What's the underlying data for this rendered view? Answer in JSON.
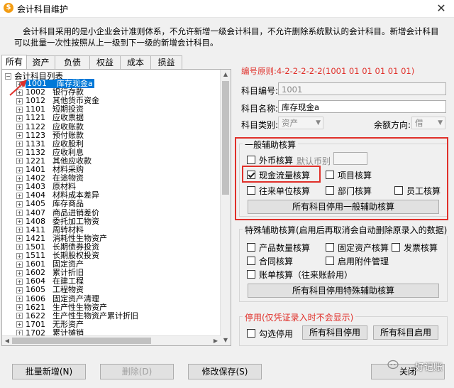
{
  "window": {
    "title": "会计科目维护",
    "close_label": "✕"
  },
  "intro_text": "会计科目采用的是小企业会计准则体系，不允许新增一级会计科目，不允许删除系统默认的会计科目。新增会计科目可以批量一次性按照从上一级到下一级的新增会计科目。",
  "tabs": [
    "所有",
    "资产",
    "负债",
    "权益",
    "成本",
    "损益"
  ],
  "tree": {
    "root_label": "会计科目列表",
    "items": [
      {
        "code": "1001",
        "name": "库存现金a"
      },
      {
        "code": "1002",
        "name": "银行存款"
      },
      {
        "code": "1012",
        "name": "其他货币资金"
      },
      {
        "code": "1101",
        "name": "短期投资"
      },
      {
        "code": "1121",
        "name": "应收票据"
      },
      {
        "code": "1122",
        "name": "应收账款"
      },
      {
        "code": "1123",
        "name": "预付账款"
      },
      {
        "code": "1131",
        "name": "应收股利"
      },
      {
        "code": "1132",
        "name": "应收利息"
      },
      {
        "code": "1221",
        "name": "其他应收款"
      },
      {
        "code": "1401",
        "name": "材料采购"
      },
      {
        "code": "1402",
        "name": "在途物资"
      },
      {
        "code": "1403",
        "name": "原材料"
      },
      {
        "code": "1404",
        "name": "材料成本差异"
      },
      {
        "code": "1405",
        "name": "库存商品"
      },
      {
        "code": "1407",
        "name": "商品进销差价"
      },
      {
        "code": "1408",
        "name": "委托加工物资"
      },
      {
        "code": "1411",
        "name": "周转材料"
      },
      {
        "code": "1421",
        "name": "消耗性生物资产"
      },
      {
        "code": "1501",
        "name": "长期债券投资"
      },
      {
        "code": "1511",
        "name": "长期股权投资"
      },
      {
        "code": "1601",
        "name": "固定资产"
      },
      {
        "code": "1602",
        "name": "累计折旧"
      },
      {
        "code": "1604",
        "name": "在建工程"
      },
      {
        "code": "1605",
        "name": "工程物资"
      },
      {
        "code": "1606",
        "name": "固定资产清理"
      },
      {
        "code": "1621",
        "name": "生产性生物资产"
      },
      {
        "code": "1622",
        "name": "生产性生物资产累计折旧"
      },
      {
        "code": "1701",
        "name": "无形资产"
      },
      {
        "code": "1702",
        "name": "累计摊销"
      }
    ]
  },
  "coding_rule": "编号原则:4-2-2-2-2-2(1001 01 01 01 01 01)",
  "form": {
    "code_label": "科目编号:",
    "code_value": "1001",
    "name_label": "科目名称:",
    "name_value": "库存现金a",
    "type_label": "科目类别:",
    "type_value": "资产",
    "direction_label": "余额方向:",
    "direction_value": "借"
  },
  "general_aux": {
    "title": "一般辅助核算",
    "foreign": "外币核算",
    "default_currency": "默认币别",
    "cashflow": "现金流量核算",
    "project": "项目核算",
    "partner": "往来单位核算",
    "department": "部门核算",
    "employee": "员工核算",
    "button": "所有科目停用一般辅助核算"
  },
  "special_aux": {
    "title": "特殊辅助核算(启用后再取消会自动删除原录入的数据)",
    "quantity": "产品数量核算",
    "fixed_asset": "固定资产核算",
    "invoice": "发票核算",
    "contract": "合同核算",
    "attachment": "启用附件管理",
    "aging": "账单核算（往来账龄用）",
    "button": "所有科目停用特殊辅助核算"
  },
  "disable_group": {
    "title": "停用(仅凭证录入时不会显示)",
    "check_label": "勾选停用",
    "disable_all": "所有科目停用",
    "enable_all": "所有科目启用"
  },
  "bottom_buttons": {
    "batch_add": "批量新增(N)",
    "delete": "删除(D)",
    "save": "修改保存(S)",
    "close": "关闭"
  },
  "watermark": "好记账",
  "colors": {
    "accent": "#0078d7",
    "highlight": "#e0302a"
  }
}
